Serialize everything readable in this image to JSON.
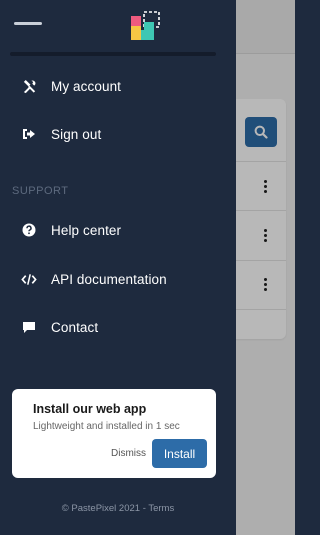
{
  "app": {
    "logo_icon": "pastepixel-logo-icon"
  },
  "menu": {
    "items": [
      {
        "label": "My account",
        "icon": "tools-icon"
      },
      {
        "label": "Sign out",
        "icon": "sign-out-icon"
      }
    ],
    "support_label": "SUPPORT",
    "support_items": [
      {
        "label": "Help center",
        "icon": "question-circle-icon"
      },
      {
        "label": "API documentation",
        "icon": "code-icon"
      },
      {
        "label": "Contact",
        "icon": "chat-bubble-icon"
      }
    ]
  },
  "install_prompt": {
    "title": "Install our web app",
    "subtitle": "Lightweight and installed in 1 sec",
    "dismiss_label": "Dismiss",
    "install_label": "Install"
  },
  "footer": {
    "copyright": "© PastePixel 2021 - ",
    "terms_label": "Terms"
  },
  "colors": {
    "drawer_bg": "#1e2a3e",
    "accent": "#2d6ca8",
    "logo_yellow": "#f6c744",
    "logo_pink": "#ee5b7f",
    "logo_teal": "#3ec7b3"
  }
}
